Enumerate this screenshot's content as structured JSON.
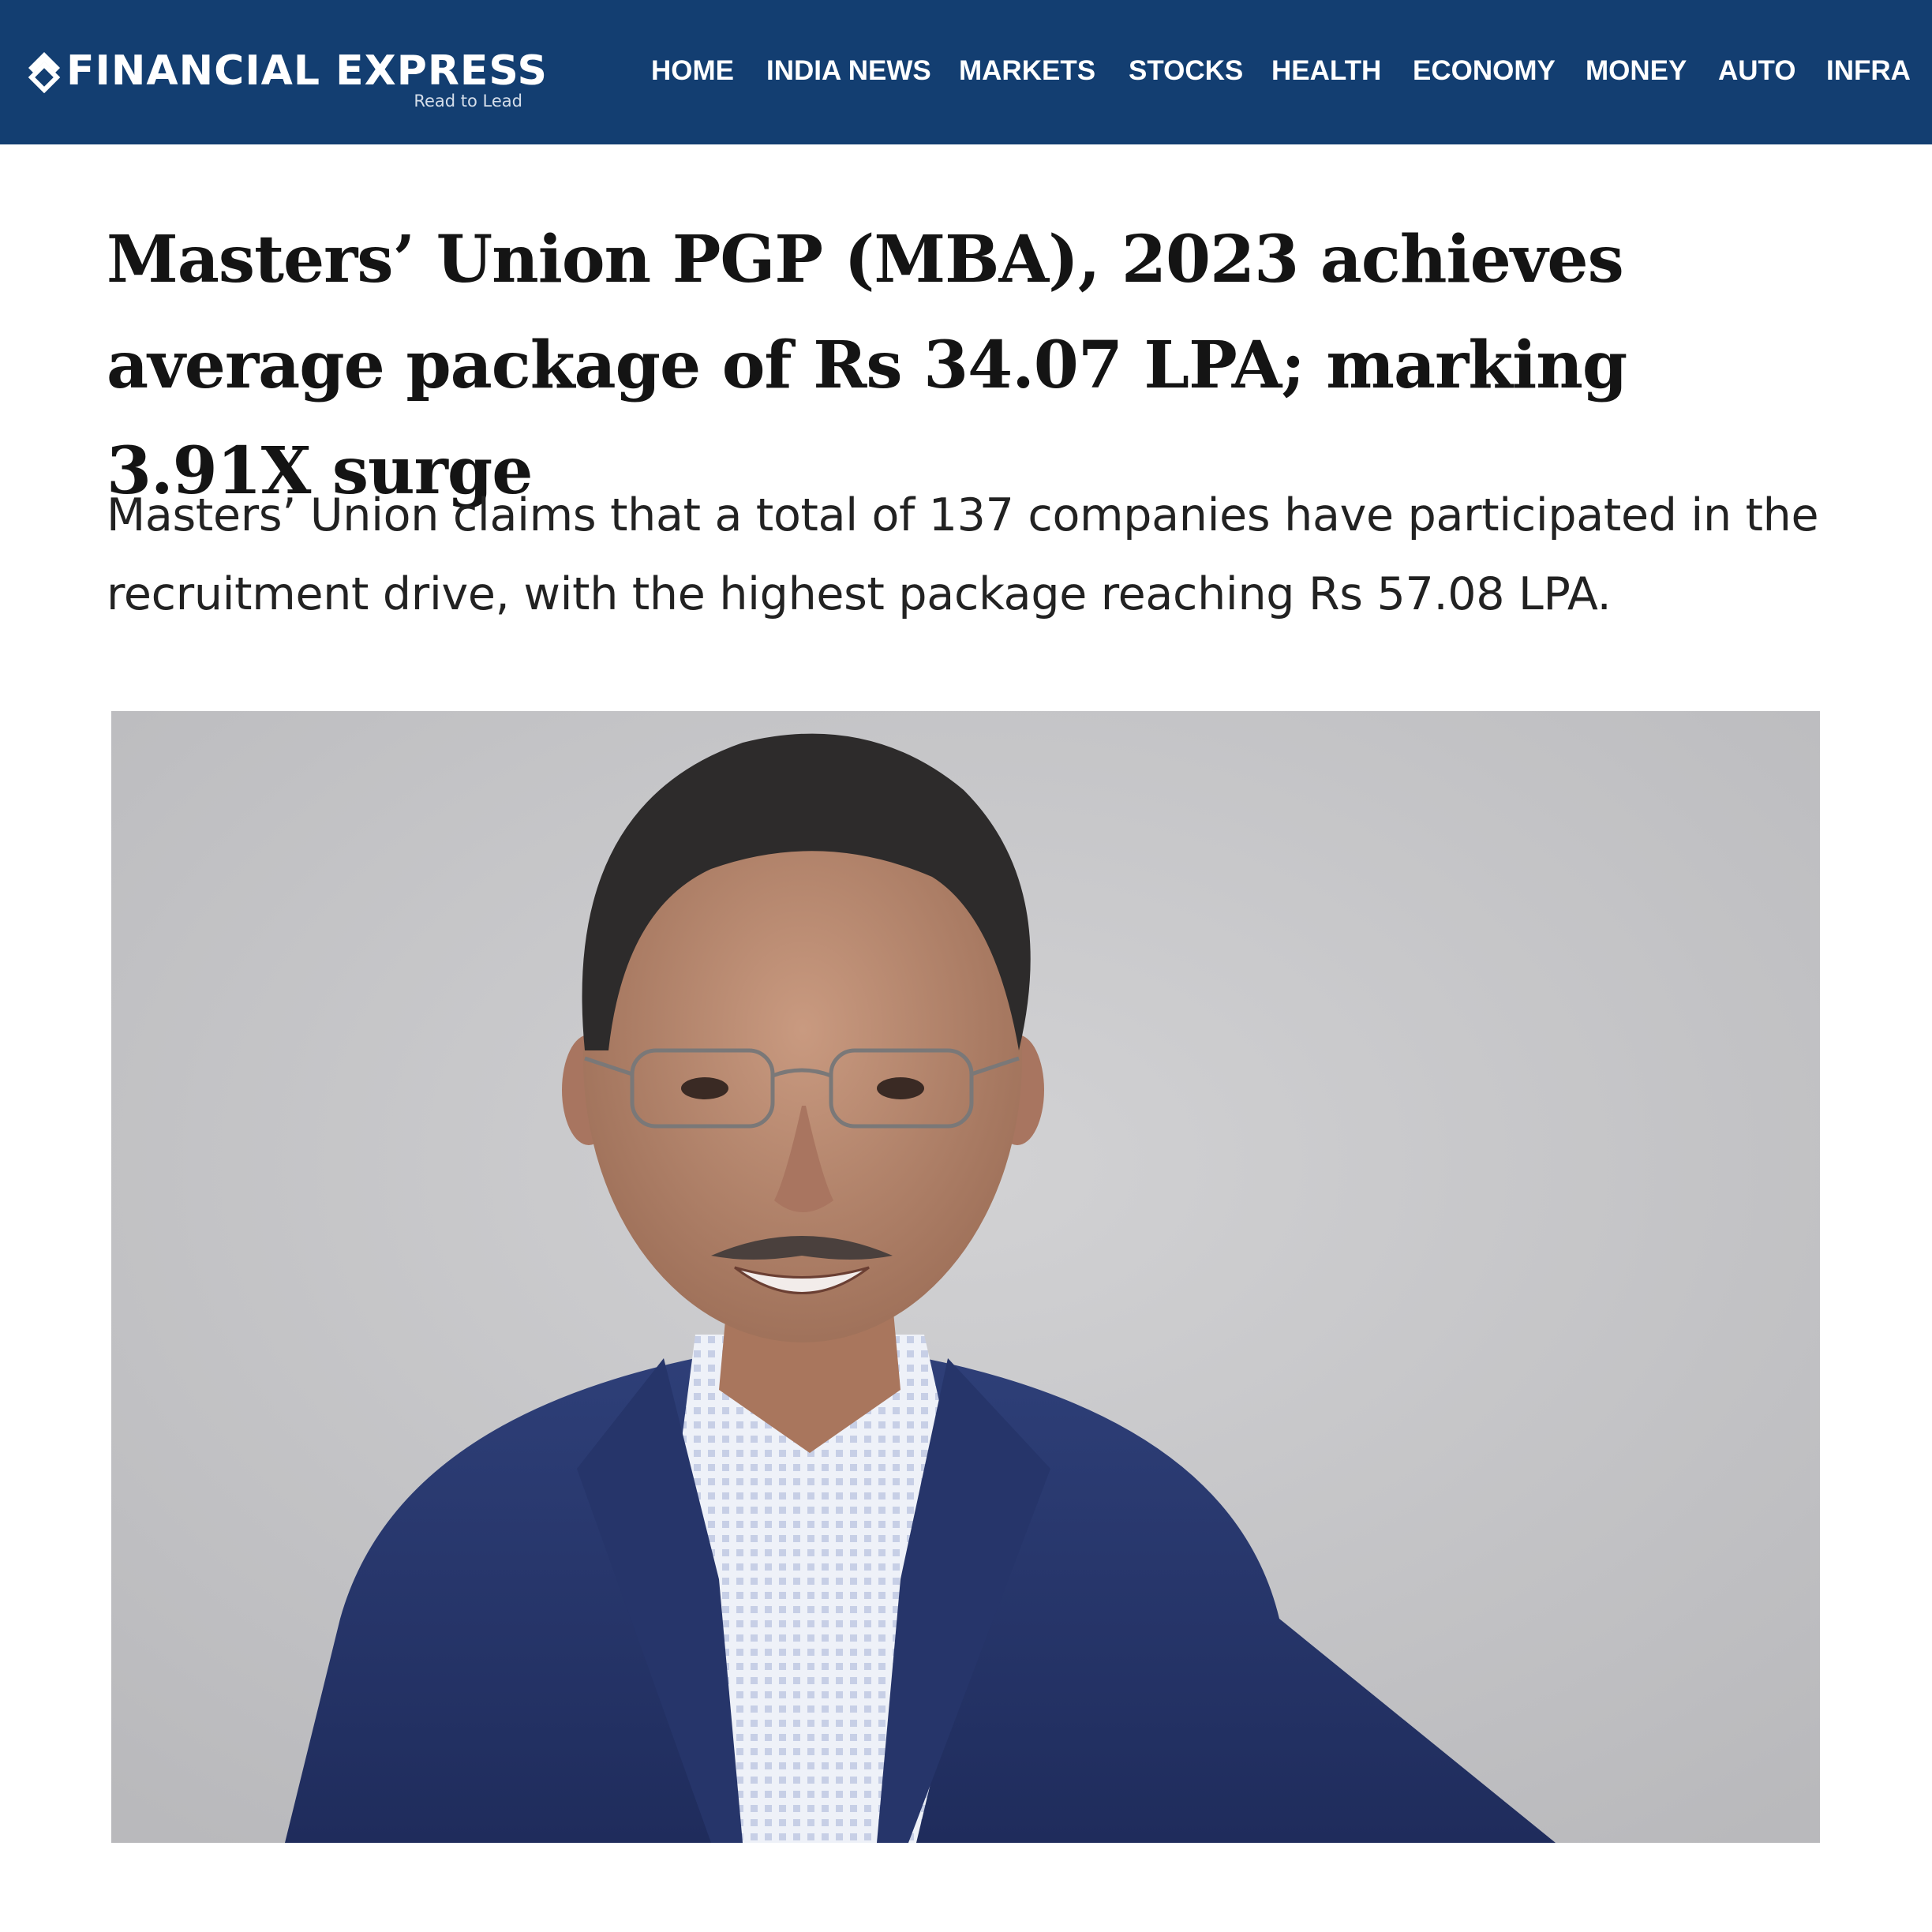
{
  "site": {
    "name": "FINANCIAL EXPRESS",
    "tagline": "Read to Lead",
    "logo_icon": "fe-diamond-icon",
    "colors": {
      "header_bg": "#133e71",
      "header_text": "#ffffff"
    }
  },
  "nav": {
    "items": [
      {
        "label": "HOME"
      },
      {
        "label": "INDIA NEWS"
      },
      {
        "label": "MARKETS"
      },
      {
        "label": "STOCKS"
      },
      {
        "label": "HEALTH"
      },
      {
        "label": "ECONOMY"
      },
      {
        "label": "MONEY"
      },
      {
        "label": "AUTO"
      },
      {
        "label": "INFRA"
      }
    ]
  },
  "article": {
    "headline": "Masters’ Union PGP (MBA), 2023 achieves average package of Rs 34.07 LPA; marking 3.91X surge",
    "standfirst": "Masters’ Union claims that a total of 137 companies have participated in the recruitment drive, with the highest package reaching Rs 57.08 LPA."
  }
}
